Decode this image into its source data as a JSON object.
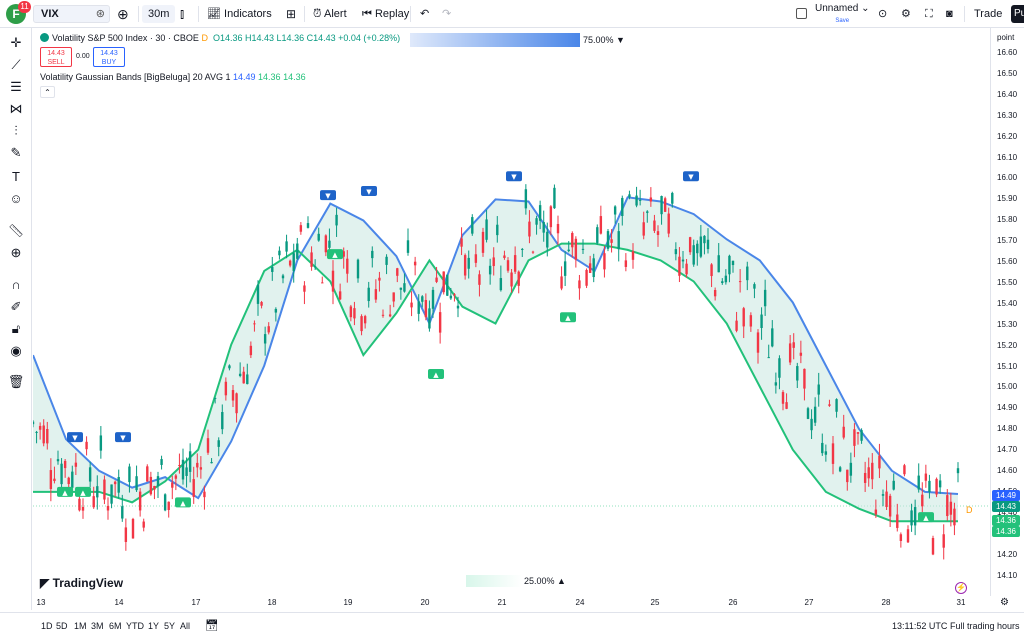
{
  "topbar": {
    "logo_letter": "F",
    "notification_count": "11",
    "symbol": "VIX",
    "timeframe": "30m",
    "indicators_label": "Indicators",
    "alert_label": "Alert",
    "replay_label": "Replay",
    "layout_name": "Unnamed",
    "save_label": "Save",
    "trade_label": "Trade",
    "publish_label": "Pu"
  },
  "legend": {
    "title": "Volatility S&P 500 Index · 30 · CBOE",
    "open": "O14.36",
    "high": "H14.43",
    "low": "L14.36",
    "close": "C14.43",
    "change": "+0.04 (+0.28%)",
    "delay_marker": "D",
    "sell_price": "14.43",
    "sell_label": "SELL",
    "spread": "0.00",
    "buy_price": "14.43",
    "buy_label": "BUY",
    "indicator_name": "Volatility Gaussian Bands [BigBeluga] 20 AVG 1",
    "indicator_v1": "14.49",
    "indicator_v2": "14.36",
    "indicator_v3": "14.36",
    "top_opacity": "75.00%",
    "bottom_opacity": "25.00%"
  },
  "price_axis": {
    "unit_label": "point",
    "ticks": [
      "16.60",
      "16.50",
      "16.40",
      "16.30",
      "16.20",
      "16.10",
      "16.00",
      "15.90",
      "15.80",
      "15.70",
      "15.60",
      "15.50",
      "15.40",
      "15.30",
      "15.20",
      "15.10",
      "15.00",
      "14.90",
      "14.80",
      "14.70",
      "14.60",
      "14.50",
      "14.40",
      "14.30",
      "14.20",
      "14.10"
    ],
    "label_upper": "14.49",
    "label_close": "14.43",
    "label_lower1": "14.36",
    "label_lower2": "14.36",
    "upper_color": "#2962ff",
    "close_color": "#089981",
    "lower_color": "#22c17a"
  },
  "time_axis": {
    "ticks": [
      "13",
      "14",
      "17",
      "18",
      "19",
      "20",
      "21",
      "24",
      "25",
      "26",
      "27",
      "28",
      "31"
    ]
  },
  "bottombar": {
    "ranges": [
      "1D",
      "5D",
      "1M",
      "3M",
      "6M",
      "YTD",
      "1Y",
      "5Y",
      "All"
    ],
    "clock": "13:11:52 UTC",
    "session": "Full trading hours"
  },
  "brand": "TradingView",
  "chart_data": {
    "type": "candlestick",
    "symbol": "VIX",
    "interval": "30",
    "ylim": [
      14.05,
      16.65
    ],
    "x_ticks": [
      "13",
      "14",
      "17",
      "18",
      "19",
      "20",
      "21",
      "24",
      "25",
      "26",
      "27",
      "28",
      "31"
    ],
    "upper_band": [
      15.15,
      14.75,
      14.6,
      14.52,
      14.57,
      14.47,
      14.74,
      15.1,
      15.6,
      15.87,
      15.79,
      15.62,
      15.3,
      15.72,
      15.89,
      15.88,
      15.65,
      15.55,
      15.9,
      15.88,
      15.82,
      15.7,
      15.6,
      15.4,
      15.1,
      14.8,
      14.6,
      14.5,
      14.49
    ],
    "lower_band": [
      14.5,
      14.5,
      14.5,
      14.45,
      14.55,
      14.7,
      15.2,
      15.55,
      15.65,
      15.5,
      15.15,
      15.35,
      15.6,
      15.38,
      15.3,
      15.6,
      15.68,
      15.68,
      15.65,
      15.6,
      15.5,
      15.3,
      15.0,
      14.7,
      14.5,
      14.42,
      14.36,
      14.36,
      14.36
    ],
    "signals": [
      {
        "type": "down",
        "price": 14.76
      },
      {
        "type": "up",
        "price": 14.5
      },
      {
        "type": "up",
        "price": 14.5
      },
      {
        "type": "down",
        "price": 14.76
      },
      {
        "type": "up",
        "price": 14.45
      },
      {
        "type": "down",
        "price": 15.91
      },
      {
        "type": "up",
        "price": 15.63
      },
      {
        "type": "down",
        "price": 15.93
      },
      {
        "type": "up",
        "price": 15.06
      },
      {
        "type": "down",
        "price": 16.0
      },
      {
        "type": "up",
        "price": 15.33
      },
      {
        "type": "down",
        "price": 16.0
      },
      {
        "type": "up",
        "price": 14.38
      }
    ],
    "last_close": 14.43
  }
}
